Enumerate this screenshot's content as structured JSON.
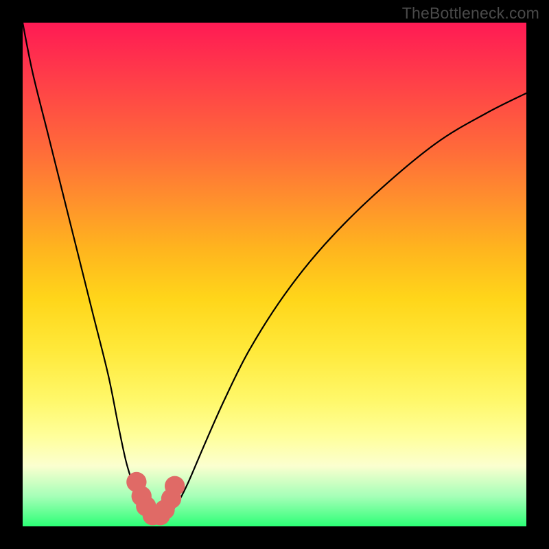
{
  "watermark": "TheBottleneck.com",
  "chart_data": {
    "type": "line",
    "title": "",
    "xlabel": "",
    "ylabel": "",
    "xlim": [
      0,
      100
    ],
    "ylim": [
      0,
      100
    ],
    "grid": false,
    "legend": false,
    "series": [
      {
        "name": "left-branch",
        "x": [
          0,
          2,
          5,
          8,
          11,
          14,
          17,
          19,
          20.5,
          22,
          23,
          24,
          24.8
        ],
        "y": [
          100,
          90,
          78,
          66,
          54,
          42,
          30,
          20,
          13,
          8,
          5,
          3,
          2.5
        ]
      },
      {
        "name": "right-branch",
        "x": [
          28.5,
          29.5,
          31,
          33,
          36,
          40,
          45,
          52,
          60,
          70,
          82,
          92,
          100
        ],
        "y": [
          2.5,
          3,
          5,
          9,
          16,
          25,
          35,
          46,
          56,
          66,
          76,
          82,
          86
        ]
      },
      {
        "name": "valley-floor",
        "x": [
          24.8,
          25.8,
          26.6,
          27.5,
          28.5
        ],
        "y": [
          2.5,
          2.0,
          1.9,
          2.0,
          2.5
        ]
      }
    ],
    "markers": {
      "name": "valley-dots",
      "color": "#e06a66",
      "radius": 2.0,
      "points_x": [
        22.6,
        23.6,
        24.5,
        25.8,
        27.3,
        28.2,
        29.5,
        30.2
      ],
      "points_y": [
        8.8,
        6.0,
        4.0,
        2.2,
        2.2,
        3.3,
        5.5,
        8.0
      ]
    }
  }
}
